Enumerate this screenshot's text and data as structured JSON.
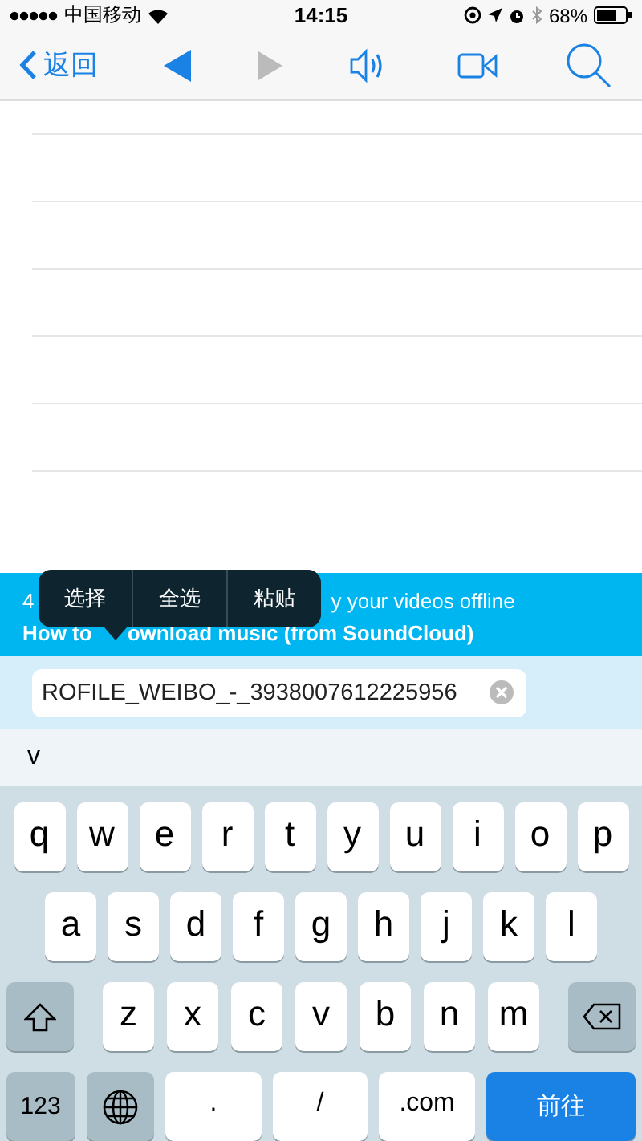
{
  "status_bar": {
    "carrier": "中国移动",
    "time": "14:15",
    "battery": "68%"
  },
  "toolbar": {
    "back_label": "返回",
    "history_back": {
      "disabled": false
    },
    "history_forward": {
      "disabled": true
    }
  },
  "banner": {
    "line_1": [
      {
        "text": "4"
      },
      {
        "text": "y your videos offline"
      }
    ],
    "line_2": [
      {
        "text": "How to"
      },
      {
        "text": "ownload music (from SoundCloud)"
      }
    ]
  },
  "edit_menu": [
    "选择",
    "全选",
    "粘贴"
  ],
  "address_field": {
    "value": "ROFILE_WEIBO_-_3938007612225956"
  },
  "suggestion": "v",
  "keyboard": {
    "row_1": [
      {
        "kind": "letter",
        "label": "q"
      },
      {
        "kind": "letter",
        "label": "w"
      },
      {
        "kind": "letter",
        "label": "e"
      },
      {
        "kind": "letter",
        "label": "r"
      },
      {
        "kind": "letter",
        "label": "t"
      },
      {
        "kind": "letter",
        "label": "y"
      },
      {
        "kind": "letter",
        "label": "u"
      },
      {
        "kind": "letter",
        "label": "i"
      },
      {
        "kind": "letter",
        "label": "o"
      },
      {
        "kind": "letter",
        "label": "p"
      }
    ],
    "row_2": [
      {
        "kind": "letter",
        "label": "a"
      },
      {
        "kind": "letter",
        "label": "s"
      },
      {
        "kind": "letter",
        "label": "d"
      },
      {
        "kind": "letter",
        "label": "f"
      },
      {
        "kind": "letter",
        "label": "g"
      },
      {
        "kind": "letter",
        "label": "h"
      },
      {
        "kind": "letter",
        "label": "j"
      },
      {
        "kind": "letter",
        "label": "k"
      },
      {
        "kind": "letter",
        "label": "l"
      }
    ],
    "row_3": [
      {
        "kind": "shift"
      },
      {
        "kind": "letter",
        "label": "z"
      },
      {
        "kind": "letter",
        "label": "x"
      },
      {
        "kind": "letter",
        "label": "c"
      },
      {
        "kind": "letter",
        "label": "v"
      },
      {
        "kind": "letter",
        "label": "b"
      },
      {
        "kind": "letter",
        "label": "n"
      },
      {
        "kind": "letter",
        "label": "m"
      },
      {
        "kind": "delete"
      }
    ],
    "bottom_row": [
      {
        "kind": "function",
        "label": "123"
      },
      {
        "kind": "globe"
      },
      {
        "kind": "wide",
        "label": "."
      },
      {
        "kind": "wide",
        "label": "/"
      },
      {
        "kind": "wide",
        "label": ".com"
      },
      {
        "kind": "go",
        "label": "前往"
      }
    ]
  }
}
